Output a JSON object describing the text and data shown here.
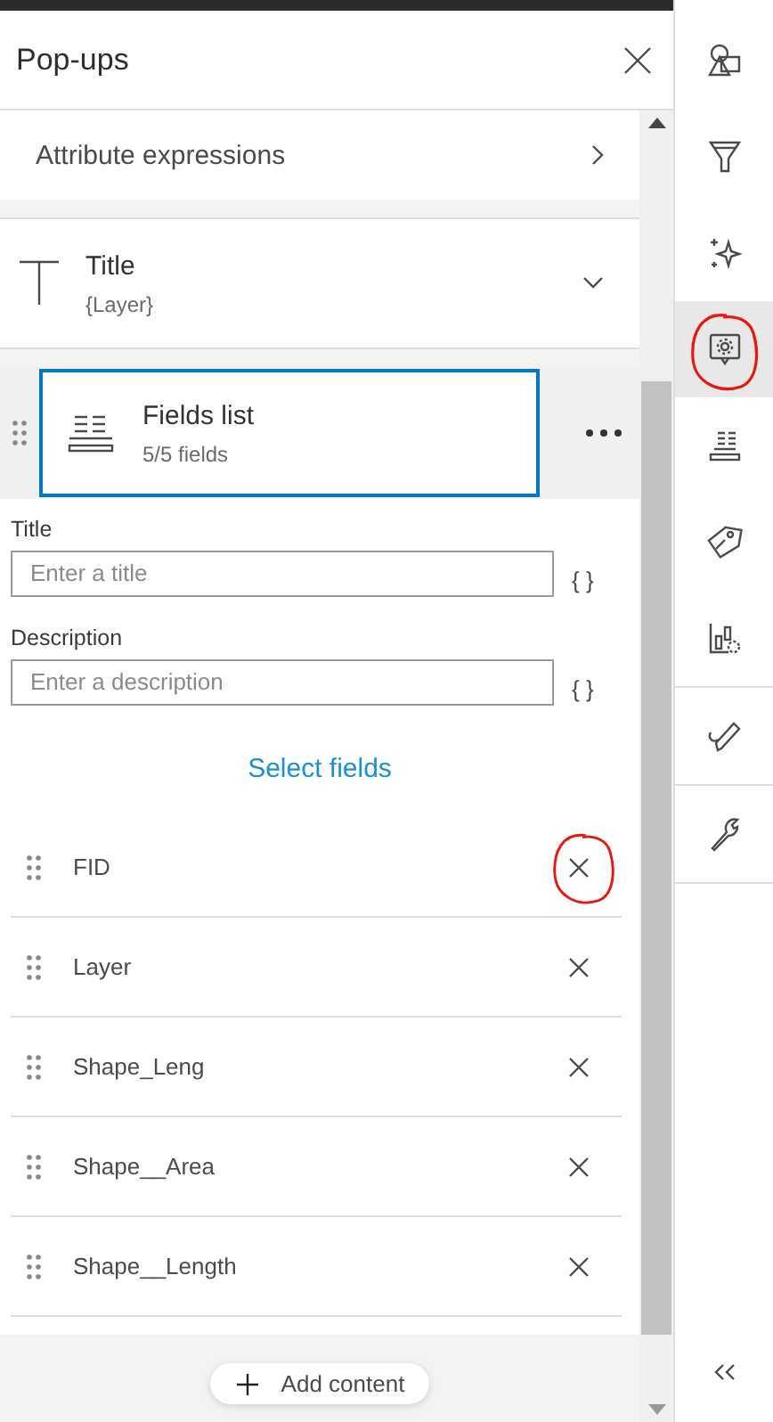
{
  "panel": {
    "title": "Pop-ups"
  },
  "attribute_expressions": {
    "label": "Attribute expressions"
  },
  "title_block": {
    "label": "Title",
    "value": "{Layer}",
    "expanded": false
  },
  "fields_block": {
    "label": "Fields list",
    "summary": "5/5 fields",
    "selected": true
  },
  "form": [
    {
      "label": "Title",
      "placeholder": "Enter a title",
      "expression_button": "{ }"
    },
    {
      "label": "Description",
      "placeholder": "Enter a description",
      "expression_button": "{ }"
    }
  ],
  "select_fields": "Select fields",
  "fields": [
    {
      "name": "FID",
      "circled": true
    },
    {
      "name": "Layer",
      "circled": false
    },
    {
      "name": "Shape_Leng",
      "circled": false
    },
    {
      "name": "Shape__Area",
      "circled": false
    },
    {
      "name": "Shape__Length",
      "circled": false
    }
  ],
  "add_content": {
    "label": "Add content"
  },
  "toolbar": {
    "groups": [
      [
        {
          "kind": "shapes",
          "selected": false,
          "circled": false
        },
        {
          "kind": "filter",
          "selected": false,
          "circled": false
        },
        {
          "kind": "sparkle",
          "selected": false,
          "circled": false
        },
        {
          "kind": "popup",
          "selected": true,
          "circled": true
        },
        {
          "kind": "fields",
          "selected": false,
          "circled": false
        },
        {
          "kind": "label",
          "selected": false,
          "circled": false
        },
        {
          "kind": "chart",
          "selected": false,
          "circled": false
        }
      ],
      [
        {
          "kind": "pencil",
          "selected": false,
          "circled": false
        }
      ],
      [
        {
          "kind": "wrench",
          "selected": false,
          "circled": false
        }
      ]
    ]
  }
}
